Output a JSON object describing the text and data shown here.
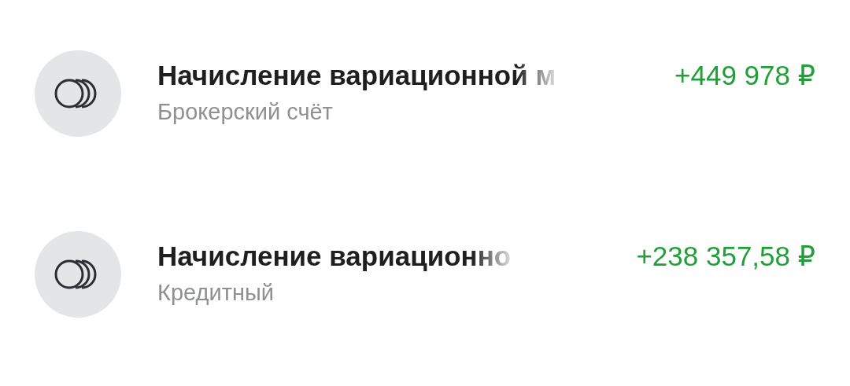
{
  "operations": [
    {
      "title": "Начисление вариационной м",
      "account": "Брокерский счёт",
      "amount": "+449 978 ₽"
    },
    {
      "title": "Начисление вариационно",
      "account": "Кредитный",
      "amount": "+238 357,58 ₽"
    }
  ]
}
